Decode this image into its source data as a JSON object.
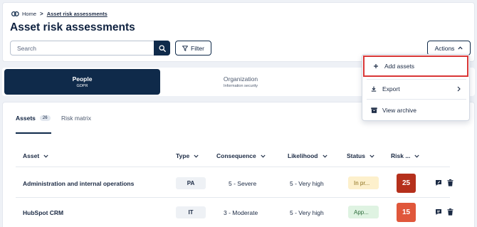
{
  "breadcrumb": {
    "home": "Home",
    "separator": ">",
    "current": "Asset risk assessments"
  },
  "page_title": "Asset risk assessments",
  "search": {
    "placeholder": "Search",
    "value": ""
  },
  "filter_label": "Filter",
  "actions_label": "Actions",
  "actions_menu": [
    {
      "label": "Add assets",
      "icon": "plus-icon",
      "highlighted": true
    },
    {
      "label": "Export",
      "icon": "download-icon",
      "submenu": true
    },
    {
      "label": "View archive",
      "icon": "archive-icon"
    }
  ],
  "segments": [
    {
      "title": "People",
      "subtitle": "GDPR",
      "active": true
    },
    {
      "title": "Organization",
      "subtitle": "Information security",
      "active": false
    }
  ],
  "tabs": [
    {
      "label": "Assets",
      "count": "26",
      "active": true
    },
    {
      "label": "Risk matrix",
      "active": false
    }
  ],
  "columns": [
    "Asset",
    "Type",
    "Consequence",
    "Likelihood",
    "Status",
    "Risk ..."
  ],
  "rows": [
    {
      "asset": "Administration and internal operations",
      "type": "PA",
      "consequence": "5 - Severe",
      "likelihood": "5 - Very high",
      "status": "In pr...",
      "status_color": "#fdf0cc",
      "risk": "25",
      "risk_color": "#b5301c"
    },
    {
      "asset": "HubSpot CRM",
      "type": "IT",
      "consequence": "3 - Moderate",
      "likelihood": "5 - Very high",
      "status": "App...",
      "status_color": "#dff3e2",
      "risk": "15",
      "risk_color": "#e0573b"
    }
  ],
  "colors": {
    "navy": "#0f2a4a",
    "highlight": "#d93636"
  }
}
